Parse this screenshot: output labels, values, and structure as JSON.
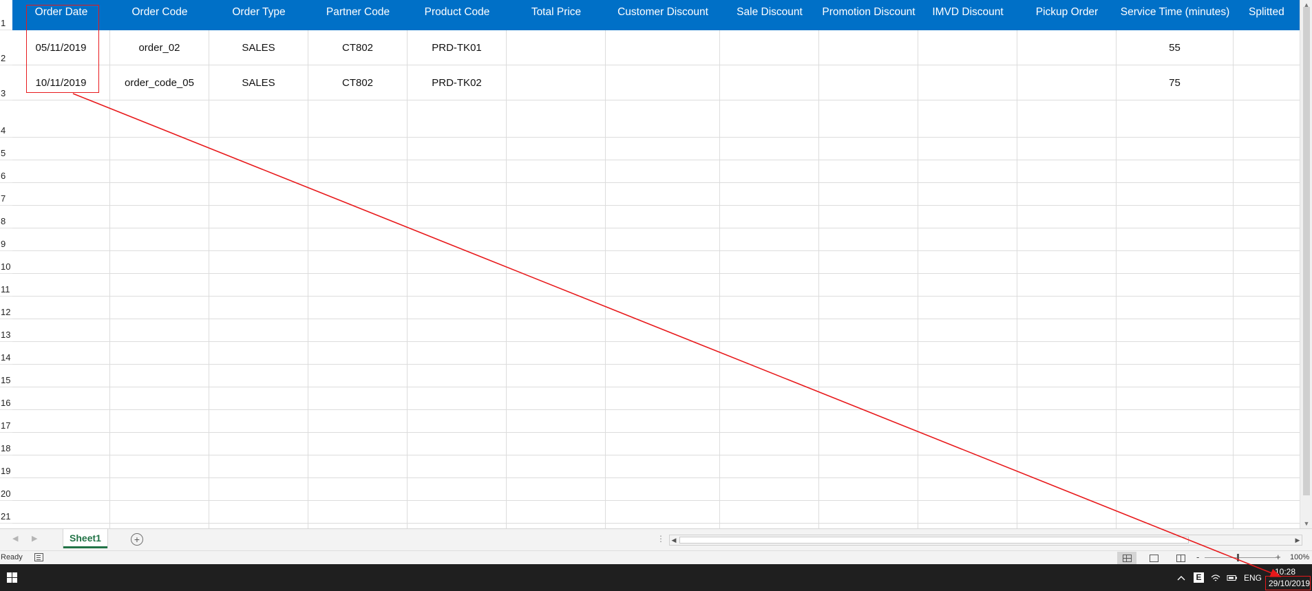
{
  "sheet": {
    "columns": [
      "Order Date",
      "Order Code",
      "Order Type",
      "Partner Code",
      "Product Code",
      "Total Price",
      "Customer Discount",
      "Sale Discount",
      "Promotion Discount",
      "IMVD Discount",
      "Pickup Order",
      "Service Time (minutes)",
      "Splitted"
    ],
    "rows": [
      [
        "05/11/2019",
        "order_02",
        "SALES",
        "CT802",
        "PRD-TK01",
        "",
        "",
        "",
        "",
        "",
        "",
        "55",
        ""
      ],
      [
        "10/11/2019",
        "order_code_05",
        "SALES",
        "CT802",
        "PRD-TK02",
        "",
        "",
        "",
        "",
        "",
        "",
        "75",
        ""
      ]
    ],
    "row_numbers": [
      "1",
      "2",
      "3",
      "4",
      "5",
      "6",
      "7",
      "8",
      "9",
      "10",
      "11",
      "12",
      "13",
      "14",
      "15",
      "16",
      "17",
      "18",
      "19",
      "20",
      "21"
    ],
    "header_color": "#0070C7",
    "annotation_color": "#E8191B"
  },
  "tabs": {
    "sheet_name": "Sheet1",
    "add_icon": "plus-circle-icon",
    "nav_prev_icon": "triangle-left-icon",
    "nav_next_icon": "triangle-right-icon"
  },
  "status": {
    "text": "Ready",
    "zoom": "100%",
    "zoom_minus": "-",
    "zoom_plus": "+"
  },
  "taskbar": {
    "language": "ENG",
    "time": "10:28",
    "date": "29/10/2019",
    "e_label": "E"
  }
}
